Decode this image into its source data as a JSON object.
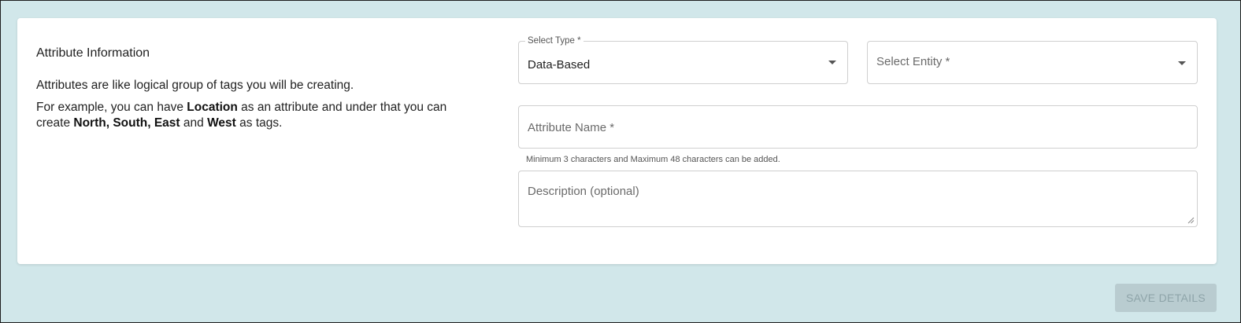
{
  "section": {
    "title": "Attribute Information",
    "desc1": "Attributes are like logical group of tags you will be creating.",
    "desc2_a": "For example, you can have ",
    "desc2_b": "Location",
    "desc2_c": " as an attribute and under that you can create ",
    "desc2_d": "North, South, East",
    "desc2_e": " and ",
    "desc2_f": "West",
    "desc2_g": " as tags."
  },
  "form": {
    "select_type": {
      "label": "Select Type *",
      "value": "Data-Based"
    },
    "select_entity": {
      "placeholder": "Select Entity *"
    },
    "attribute_name": {
      "placeholder": "Attribute Name *",
      "helper": "Minimum 3 characters and Maximum 48 characters can be added."
    },
    "description": {
      "placeholder": "Description (optional)"
    }
  },
  "actions": {
    "save_label": "SAVE DETAILS"
  },
  "colors": {
    "background": "#d1e7ea",
    "card": "#ffffff",
    "button_disabled": "#b9ccd0"
  },
  "icons": {
    "dropdown": "caret-down-icon",
    "resize": "resize-handle-icon"
  }
}
